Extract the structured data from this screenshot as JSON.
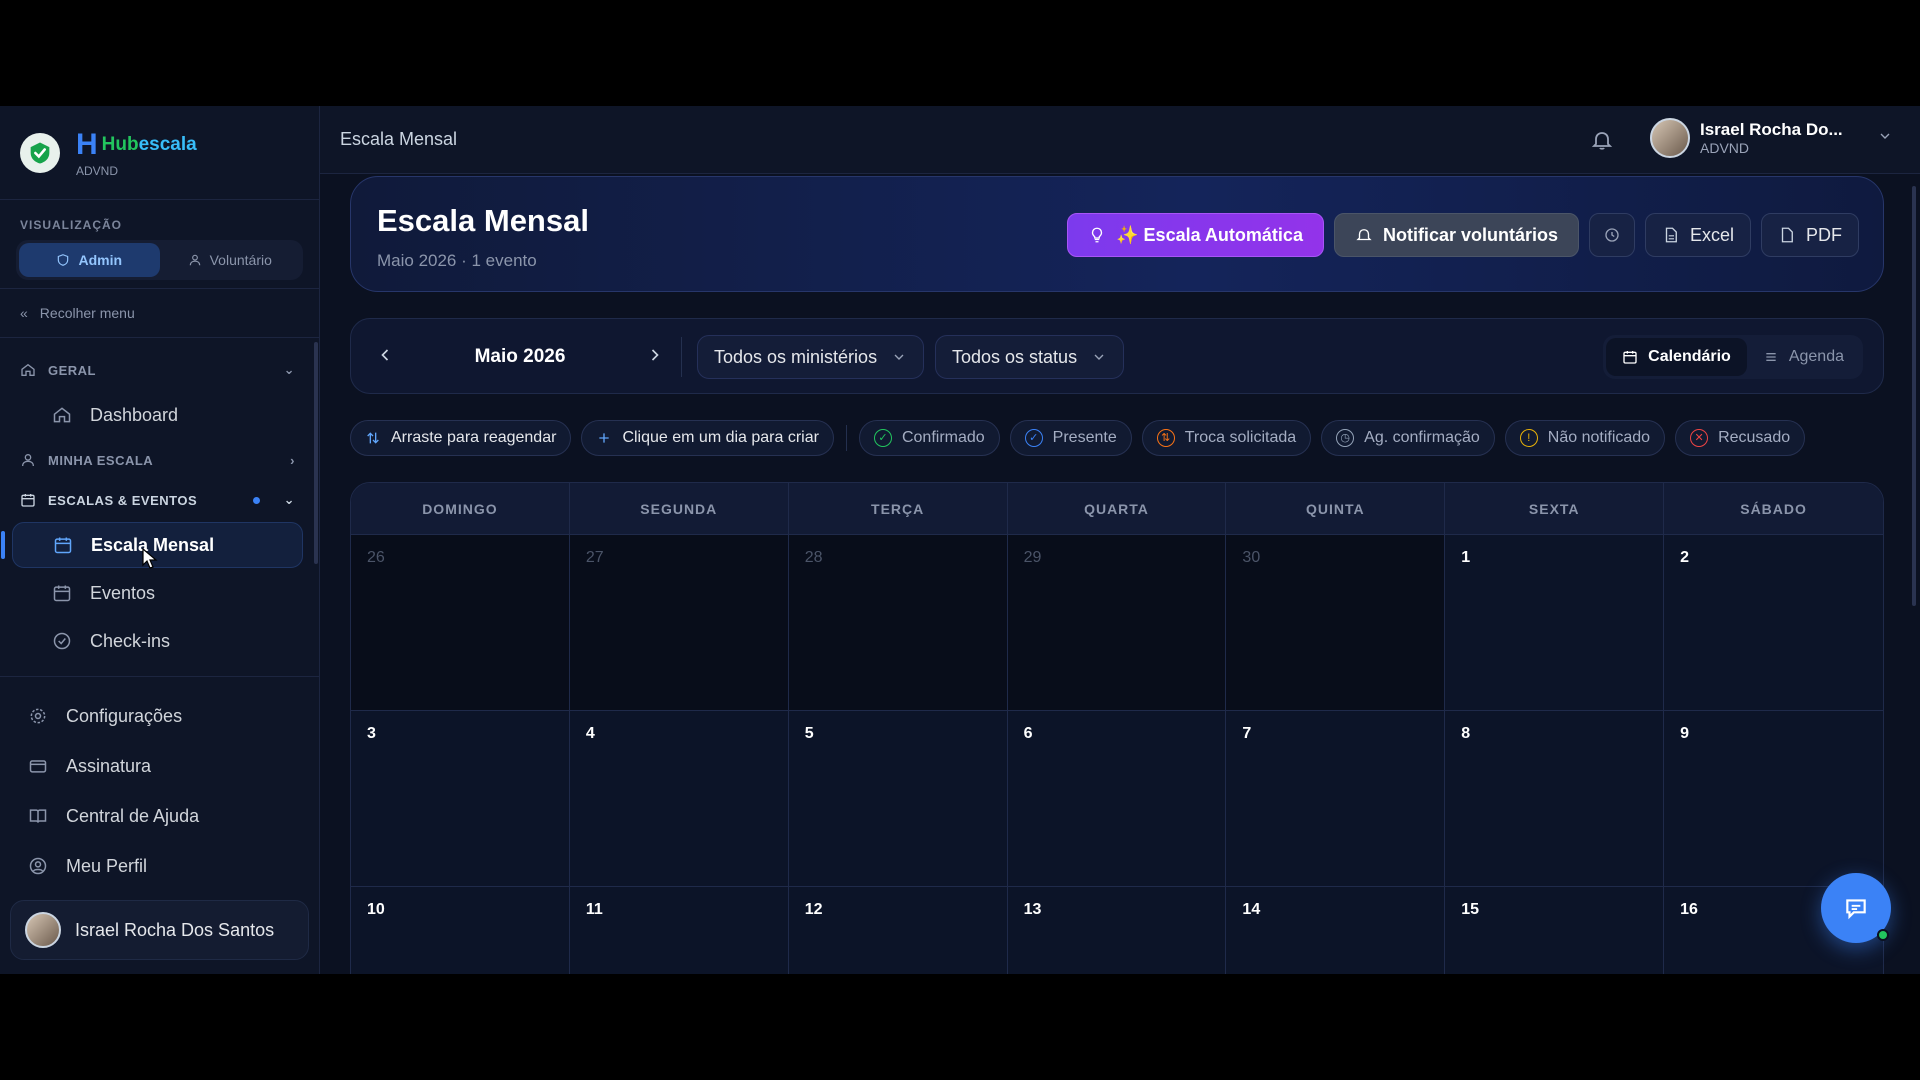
{
  "brand": {
    "name_h": "H",
    "name_hub": "Hub",
    "name_escala": "escala",
    "org": "ADVND"
  },
  "sidebar": {
    "view_label": "VISUALIZAÇÃO",
    "view_admin": "Admin",
    "view_volunteer": "Voluntário",
    "collapse_label": "Recolher menu",
    "groups": [
      {
        "label": "GERAL",
        "items": [
          "Dashboard"
        ]
      },
      {
        "label": "MINHA ESCALA"
      },
      {
        "label": "ESCALAS & EVENTOS",
        "items": [
          "Escala Mensal",
          "Eventos",
          "Check-ins"
        ]
      }
    ],
    "bottom": [
      "Configurações",
      "Assinatura",
      "Central de Ajuda",
      "Meu Perfil"
    ],
    "user_name": "Israel Rocha Dos Santos"
  },
  "topbar": {
    "title": "Escala Mensal",
    "user_name": "Israel Rocha Do...",
    "user_org": "ADVND"
  },
  "hero": {
    "title": "Escala Mensal",
    "subtitle": "Maio 2026 · 1 evento",
    "btn_auto": "✨ Escala Automática",
    "btn_notify": "Notificar voluntários",
    "btn_excel": "Excel",
    "btn_pdf": "PDF"
  },
  "filters": {
    "month": "Maio 2026",
    "ministry": "Todos os ministérios",
    "status": "Todos os status",
    "view_calendar": "Calendário",
    "view_agenda": "Agenda"
  },
  "legend": {
    "drag": "Arraste para reagendar",
    "click": "Clique em um dia para criar",
    "statuses": [
      {
        "label": "Confirmado",
        "color": "#22c55e"
      },
      {
        "label": "Presente",
        "color": "#3b82f6"
      },
      {
        "label": "Troca solicitada",
        "color": "#f97316"
      },
      {
        "label": "Ag. confirmação",
        "color": "#94a3b8"
      },
      {
        "label": "Não notificado",
        "color": "#eab308"
      },
      {
        "label": "Recusado",
        "color": "#ef4444"
      }
    ]
  },
  "calendar": {
    "weekdays": [
      "DOMINGO",
      "SEGUNDA",
      "TERÇA",
      "QUARTA",
      "QUINTA",
      "SEXTA",
      "SÁBADO"
    ],
    "days": [
      "26",
      "27",
      "28",
      "29",
      "30",
      "1",
      "2",
      "3",
      "4",
      "5",
      "6",
      "7",
      "8",
      "9",
      "10",
      "11",
      "12",
      "13",
      "14",
      "15",
      "16"
    ],
    "muted_count": 5
  },
  "colors": {
    "accent": "#3b82f6",
    "purple": "#7c3aed",
    "bg": "#0b1121"
  }
}
